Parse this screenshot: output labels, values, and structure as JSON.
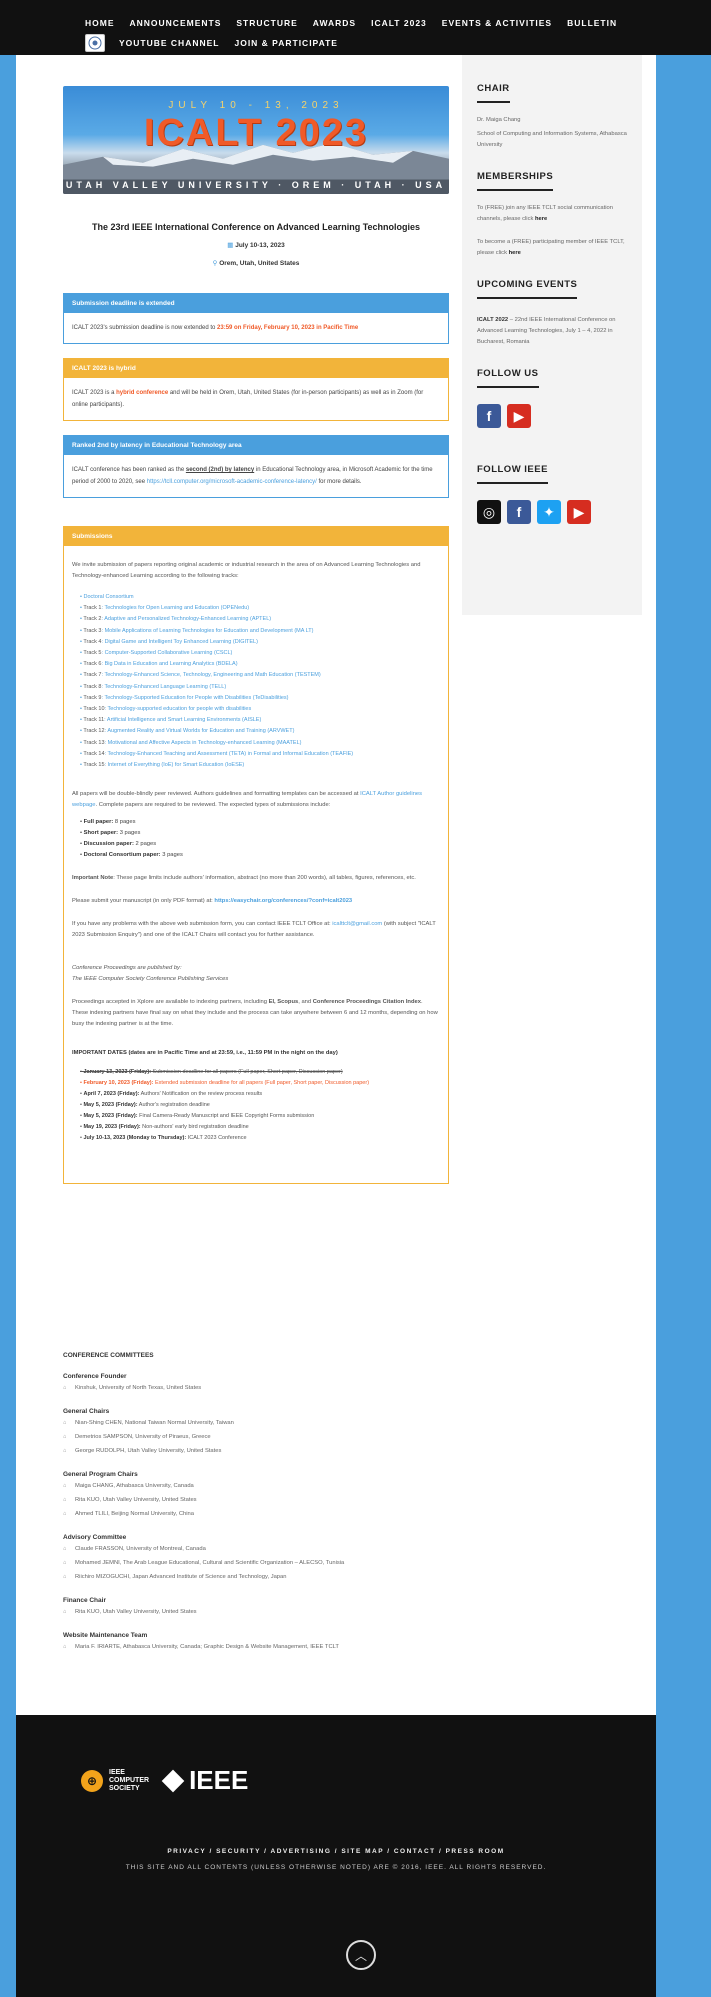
{
  "nav": {
    "row1": [
      "HOME",
      "ANNOUNCEMENTS",
      "STRUCTURE",
      "AWARDS",
      "ICALT 2023",
      "EVENTS & ACTIVITIES",
      "BULLETIN"
    ],
    "row2": [
      "YOUTUBE CHANNEL",
      "JOIN & PARTICIPATE"
    ]
  },
  "banner": {
    "dates": "JULY 10 - 13, 2023",
    "title": "ICALT 2023",
    "place": "UTAH VALLEY UNIVERSITY · OREM · UTAH · USA"
  },
  "conference": {
    "title": "The 23rd IEEE International Conference on Advanced Learning Technologies",
    "date": "July 10-13, 2023",
    "location": "Orem, Utah, United States"
  },
  "boxes": {
    "deadline": {
      "header": "Submission deadline is extended",
      "text_a": "ICALT 2023's submission deadline is now extended to ",
      "highlight": "23:59 on Friday, February 10, 2023 in Pacific Time"
    },
    "hybrid": {
      "header": "ICALT 2023 is hybrid",
      "text_a": "ICALT 2023 is a ",
      "highlight": "hybrid conference",
      "text_b": " and will be held in Orem, Utah, United States (for in-person participants) as well as in Zoom (for online participants)."
    },
    "ranked": {
      "header": "Ranked 2nd by latency in Educational Technology area",
      "text_a": "ICALT conference has been ranked as the ",
      "text_b": "second (2nd) by latency",
      "text_c": " in Educational Technology area, in Microsoft Academic for the time period of 2000 to 2020, see ",
      "link": "https://tcll.computer.org/microsoft-academic-conference-latency/",
      "text_d": " for more details."
    },
    "submissions": {
      "header": "Submissions",
      "intro": "We invite submission of papers reporting original academic or industrial research in the area of on Advanced Learning Technologies and Technology-enhanced Learning according to the following tracks:",
      "tracks": [
        {
          "n": "",
          "t": "Doctoral Consortium"
        },
        {
          "n": "Track 1",
          "t": "Technologies for Open Learning and Education (OPENedu)"
        },
        {
          "n": "Track 2",
          "t": "Adaptive and Personalized Technology-Enhanced Learning (APTEL)"
        },
        {
          "n": "Track 3",
          "t": "Mobile Applications of Learning Technologies for Education and Development (MA LT)"
        },
        {
          "n": "Track 4",
          "t": "Digital Game and Intelligent Toy Enhanced Learning (DIGITEL)"
        },
        {
          "n": "Track 5",
          "t": "Computer-Supported Collaborative Learning (CSCL)"
        },
        {
          "n": "Track 6",
          "t": "Big Data in Education and Learning Analytics (BDELA)"
        },
        {
          "n": "Track 7",
          "t": "Technology-Enhanced Science, Technology, Engineering and Math Education (TESTEM)"
        },
        {
          "n": "Track 8",
          "t": "Technology-Enhanced Language Learning (TELL)"
        },
        {
          "n": "Track 9",
          "t": "Technology-Supported Education for People with Disabilities (TeDisabilities)"
        },
        {
          "n": "Track 10",
          "t": "Technology-supported education for people with disabilities"
        },
        {
          "n": "Track 11",
          "t": "Artificial Intelligence and Smart Learning Environments (AISLE)"
        },
        {
          "n": "Track 12",
          "t": "Augmented Reality and Virtual Worlds for Education and Training (ARVWET)"
        },
        {
          "n": "Track 13",
          "t": "Motivational and Affective Aspects in Technology-enhanced Learning (MAATEL)"
        },
        {
          "n": "Track 14",
          "t": "Technology-Enhanced Teaching and Assessment (TETA) in Formal and Informal Education (TEAFIE)"
        },
        {
          "n": "Track 15",
          "t": "Internet of Everything (IoE) for Smart Education (IoESE)"
        }
      ],
      "review_text": "All papers will be double-blindly peer reviewed. Authors guidelines and formatting templates can be accessed at ",
      "review_link": "ICALT Author guidelines webpage",
      "review_text2": ". Complete papers are required to be reviewed. The expected types of submissions include:",
      "types": [
        {
          "k": "Full paper:",
          "v": " 8 pages"
        },
        {
          "k": "Short paper:",
          "v": " 3 pages"
        },
        {
          "k": "Discussion paper:",
          "v": " 2 pages"
        },
        {
          "k": "Doctoral Consortium paper:",
          "v": " 3 pages"
        }
      ],
      "note_label": "Important Note",
      "note_text": ": These page limits include authors' information, abstract (no more than 200 words), all tables, figures, references, etc.",
      "submit_text": "Please submit your manuscript (in only PDF format) at: ",
      "submit_link": "https://easychair.org/conferences/?conf=icalt2023",
      "problem_text": "If you have any problems with the above web submission form, you can contact IEEE TCLT Office at: ",
      "problem_link": "icalttclt@gmail.com",
      "problem_text2": " (with subject \"ICALT 2023 Submission Enquiry\") and one of the ICALT Chairs will contact you for further assistance.",
      "proc_line1": "Conference Proceedings are published by:",
      "proc_line2": "The IEEE Computer Society Conference Publishing Services",
      "index_text_a": "Proceedings accepted in Xplore are available to indexing partners, including ",
      "index_ei": "EI, Scopus",
      "index_text_b": ", and ",
      "index_cpci": "Conference Proceedings Citation Index",
      "index_text_c": ". These indexing partners have final say on what they include and the process can take anywhere between 6 and 12 months, depending on how busy the indexing partner is at the time.",
      "dates_header": "IMPORTANT DATES (dates are in Pacific Time and at 23:59, i.e., 11:59 PM in the night on the day)",
      "dates": [
        {
          "d": "January 13, 2023 (Friday):",
          "t": " Submission deadline for all papers (Full paper, Short paper, Discussion paper)",
          "s": true,
          "o": false
        },
        {
          "d": "February 10, 2023 (Friday):",
          "t": " Extended submission deadline for all papers (Full paper, Short paper, Discussion paper)",
          "s": false,
          "o": true
        },
        {
          "d": "April 7, 2023 (Friday):",
          "t": " Authors' Notification on the review process results",
          "s": false,
          "o": false
        },
        {
          "d": "May 5, 2023 (Friday):",
          "t": " Author's registration deadline",
          "s": false,
          "o": false
        },
        {
          "d": "May 5, 2023 (Friday):",
          "t": " Final Camera-Ready Manuscript and IEEE Copyright Forms submission",
          "s": false,
          "o": false
        },
        {
          "d": "May 19, 2023 (Friday):",
          "t": " Non-authors' early bird registration deadline",
          "s": false,
          "o": false
        },
        {
          "d": "July 10-13, 2023 (Monday to Thursday):",
          "t": " ICALT 2023 Conference",
          "s": false,
          "o": false
        }
      ]
    }
  },
  "committee": {
    "title": "CONFERENCE COMMITTEES",
    "groups": [
      {
        "h": "Conference Founder",
        "m": [
          "Kinshuk, University of North Texas, United States"
        ]
      },
      {
        "h": "General Chairs",
        "m": [
          "Nian-Shing CHEN, National Taiwan Normal University, Taiwan",
          "Demetrios SAMPSON, University of Piraeus, Greece",
          "George RUDOLPH, Utah Valley University, United States"
        ]
      },
      {
        "h": "General Program Chairs",
        "m": [
          "Maiga CHANG, Athabasca University, Canada",
          "Rita KUO, Utah Valley University, United States",
          "Ahmed TLILI, Beijing Normal University, China"
        ]
      },
      {
        "h": "Advisory Committee",
        "m": [
          "Claude FRASSON, University of Montreal, Canada",
          "Mohamed JEMNI, The Arab League Educational, Cultural and Scientific Organization – ALECSO, Tunisia",
          "Riichiro MIZOGUCHI, Japan Advanced Institute of Science and Technology, Japan"
        ]
      },
      {
        "h": "Finance Chair",
        "m": [
          "Rita KUO, Utah Valley University, United States"
        ]
      },
      {
        "h": "Website Maintenance Team",
        "m": [
          "Maria F. IRIARTE, Athabasca University, Canada; Graphic Design & Website Management, IEEE TCLT"
        ]
      }
    ]
  },
  "sidebar": {
    "chair_title": "CHAIR",
    "chair_name": "Dr. Maiga Chang",
    "chair_aff": "School of Computing and Information Systems, Athabasca University",
    "mem_title": "MEMBERSHIPS",
    "mem_text1": "To (FREE) join any IEEE TCLT social communication channels, please click ",
    "mem_here": "here",
    "mem_text2": "To become a (FREE) participating member of IEEE TCLT, please click ",
    "events_title": "UPCOMING EVENTS",
    "events_bold": "ICALT 2022",
    "events_text": " – 22nd IEEE International Conference on Advanced Learning Technologies, July 1 – 4, 2022 in Bucharest, Romania",
    "follow_us": "FOLLOW US",
    "follow_ieee": "FOLLOW IEEE",
    "colors": {
      "facebook": "#3b5998",
      "youtube": "#d62d20",
      "twitter": "#1da1f2",
      "instagram": "#111111"
    }
  },
  "footer": {
    "cs1": "IEEE",
    "cs2": "COMPUTER",
    "cs3": "SOCIETY",
    "ieee": "IEEE",
    "links": [
      "PRIVACY",
      "SECURITY",
      "ADVERTISING",
      "SITE MAP",
      "CONTACT",
      "PRESS ROOM"
    ],
    "copy": "THIS SITE AND ALL CONTENTS (UNLESS OTHERWISE NOTED) ARE © 2016, IEEE. ALL RIGHTS RESERVED."
  }
}
